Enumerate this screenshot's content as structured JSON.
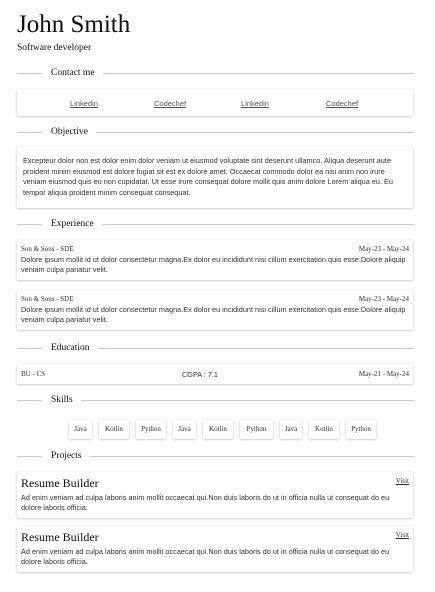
{
  "header": {
    "name": "John Smith",
    "role": "Software developer"
  },
  "sections": {
    "contact": "Contact me",
    "objective": "Objective",
    "experience": "Experience",
    "education": "Education",
    "skills": "Skills",
    "projects": "Projects"
  },
  "contact": {
    "links": [
      "Linkedin",
      "Codechef",
      "Linkedin",
      "Codechef"
    ]
  },
  "objective": {
    "text": "Excepteur dolor non est dolor enim dolor veniam ut eiusmod voluptate sint deserunt ullamco. Aliqua deserunt aute proident minim eiusmod est dolore fugiat sit est ex dolore amet. Occaecat commodo dolor ea nisi anim non irure veniam eiusmod quis eu non cupidatat. Ut esse irure consequat dolore mollit quis anim dolore Lorem aliqua eu. Eu tempor aliqua proident minim consequat consequat."
  },
  "experience": [
    {
      "org": "Son & Sons  -  SDE",
      "dates": "May-23  -  May-24",
      "desc": "Dolore ipsum mollit id ut dolor consectetur magna.Ex dolor eu incididunt nisi cillum exercitation quis esse.Dolore aliquip veniam culpa pariatur velit."
    },
    {
      "org": "Son & Sons  -  SDE",
      "dates": "May-23  -  May-24",
      "desc": "Dolore ipsum mollit id ut dolor consectetur magna.Ex dolor eu incididunt nisi cillum exercitation quis esse.Dolore aliquip veniam culpa pariatur velit."
    }
  ],
  "education": {
    "degree": "BU - CS",
    "cgpa": "CGPA : 7.1",
    "dates": "May-21  -  May-24"
  },
  "skills": [
    "Java",
    "Kotlin",
    "Python",
    "Java",
    "Kotlin",
    "Python",
    "Java",
    "Kotlin",
    "Python"
  ],
  "projects": [
    {
      "title": "Resume Builder",
      "link": "Visit",
      "desc": "Ad enim veniam ad culpa laboris anim mollit occaecat qui.Non duis laboris do ut in officia nulla ut consequat do eu dolore laboris officia."
    },
    {
      "title": "Resume Builder",
      "link": "Visit",
      "desc": "Ad enim veniam ad culpa laboris anim mollit occaecat qui.Non duis laboris do ut in officia nulla ut consequat do eu dolore laboris officia."
    }
  ]
}
